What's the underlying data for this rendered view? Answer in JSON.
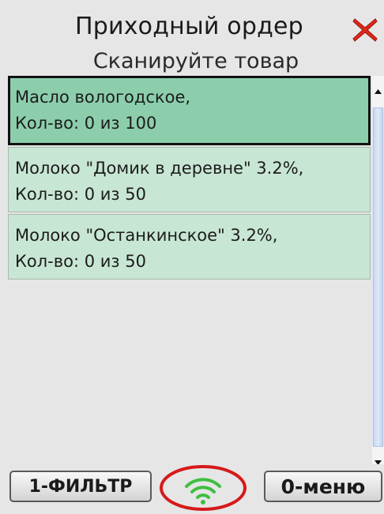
{
  "header": {
    "title": "Приходный ордер",
    "close_icon": "close-x-icon",
    "close_color": "#e0281c"
  },
  "subtitle": "Сканируйте товар",
  "items": [
    {
      "name": "Масло вологодское,",
      "qty": "Кол-во: 0 из 100",
      "selected": true
    },
    {
      "name": "Молоко \"Домик в деревне\" 3.2%,",
      "qty": "Кол-во: 0 из 50",
      "selected": false
    },
    {
      "name": "Молоко \"Останкинское\" 3.2%,",
      "qty": "Кол-во: 0 из 50",
      "selected": false
    }
  ],
  "footer": {
    "filter_label": "1-ФИЛЬТР",
    "menu_label": "0-меню",
    "status_icon": "wifi-icon",
    "status_color": "#3fbf3f",
    "highlight_color": "#d61a1a"
  },
  "colors": {
    "item_bg": "#c8e6d4",
    "selected_bg": "#8cceac"
  }
}
